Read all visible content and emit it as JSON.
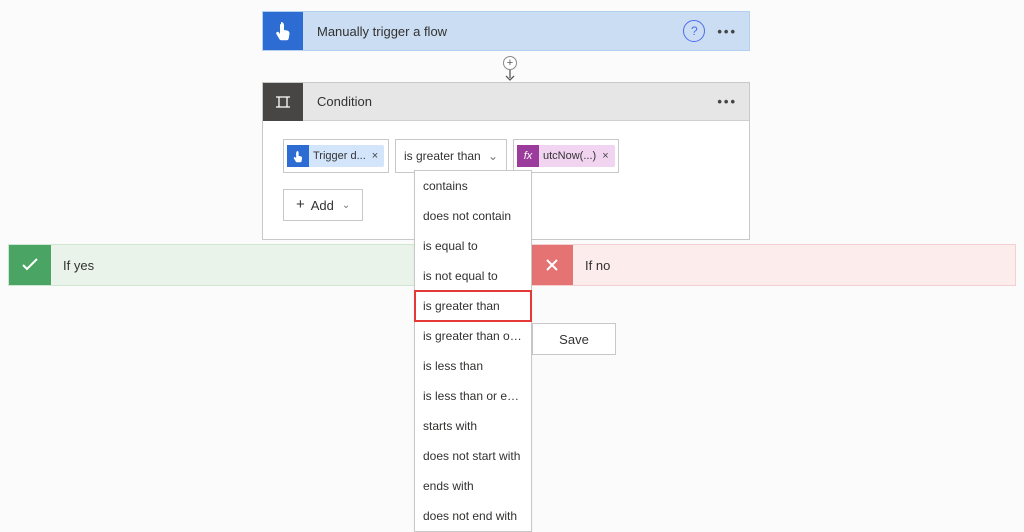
{
  "trigger": {
    "title": "Manually trigger a flow"
  },
  "condition": {
    "title": "Condition",
    "left_token": {
      "label": "Trigger d...",
      "icon": "touch"
    },
    "operator_selected": "is greater than",
    "right_token": {
      "label": "utcNow(...)",
      "icon": "fx"
    },
    "add_label": "Add"
  },
  "dropdown_options": [
    "contains",
    "does not contain",
    "is equal to",
    "is not equal to",
    "is greater than",
    "is greater than or equal to",
    "is less than",
    "is less than or equal to",
    "starts with",
    "does not start with",
    "ends with",
    "does not end with"
  ],
  "highlight_index": 4,
  "branch_yes": "If yes",
  "branch_no": "If no",
  "save_label": "Save"
}
